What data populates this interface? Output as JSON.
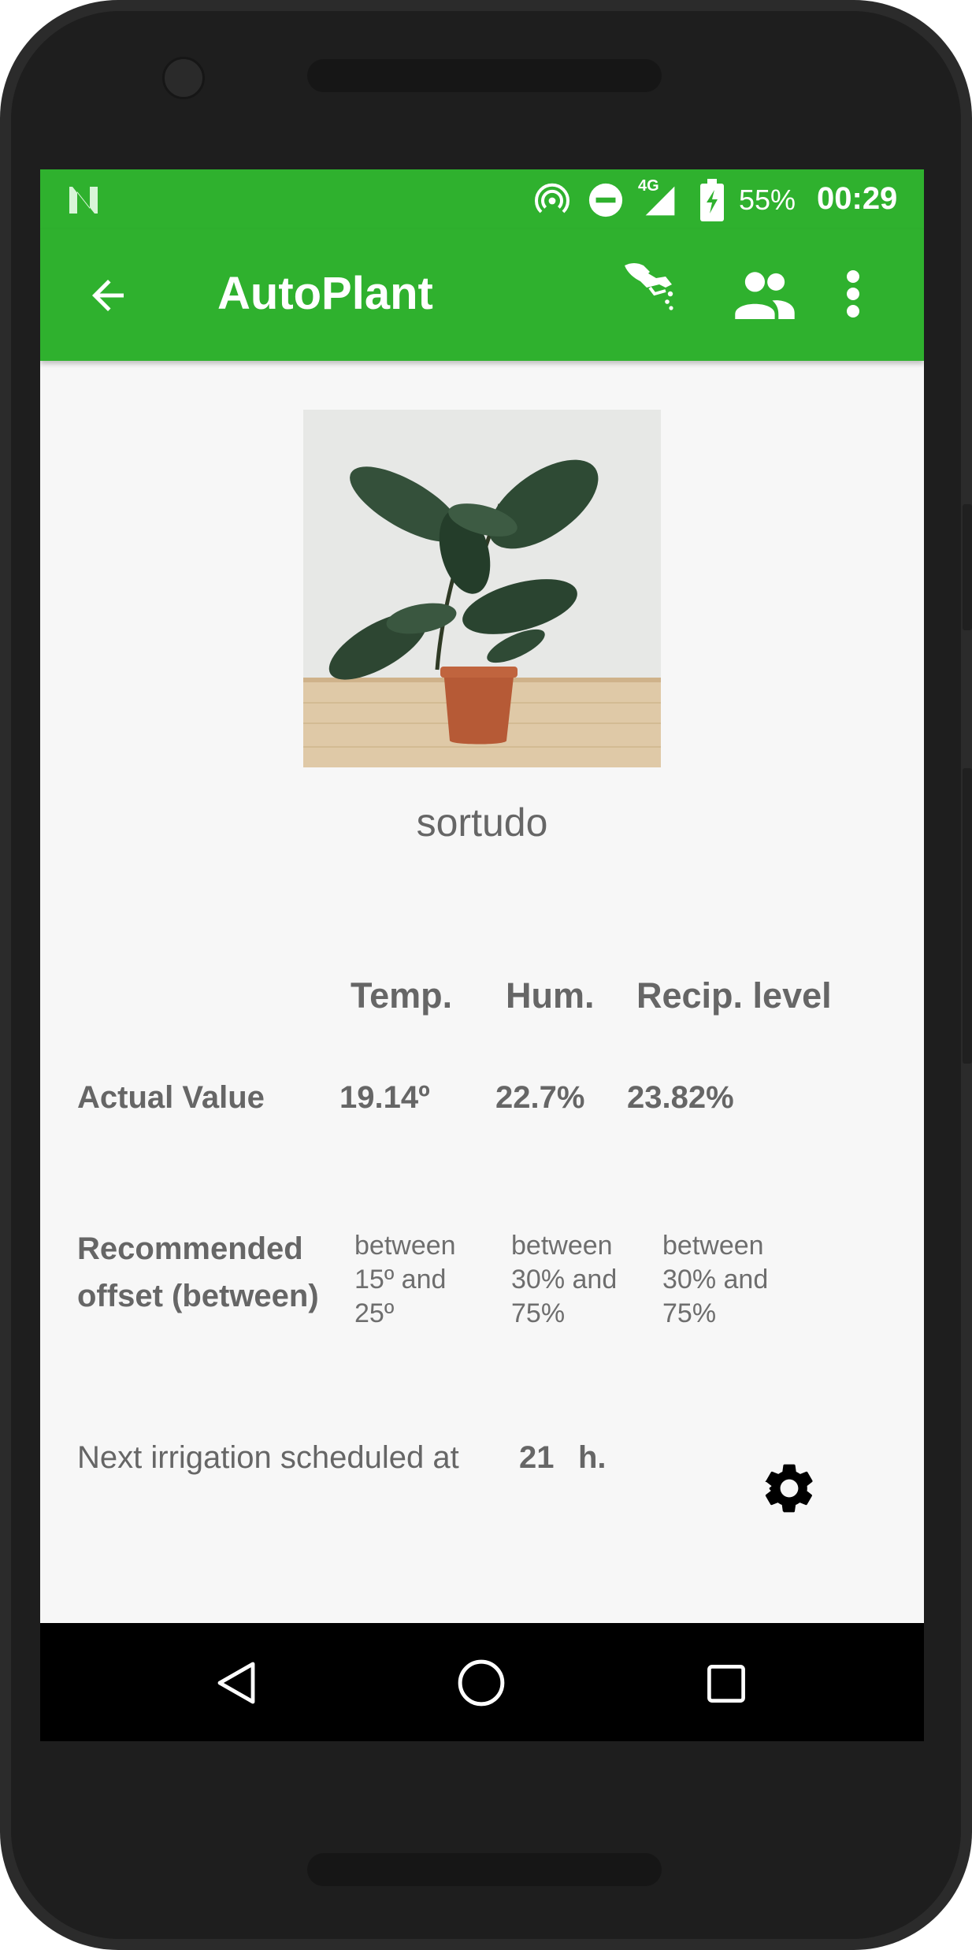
{
  "status_bar": {
    "battery_percent": "55%",
    "time": "00:29",
    "network_label": "4G",
    "icons": [
      "notification-n-icon",
      "hotspot-icon",
      "do-not-disturb-icon",
      "signal-icon",
      "battery-icon"
    ]
  },
  "app_bar": {
    "title": "AutoPlant",
    "actions": [
      "back-arrow-icon",
      "watering-can-icon",
      "people-icon",
      "more-vert-icon"
    ]
  },
  "plant": {
    "name": "sortudo"
  },
  "table": {
    "headers": [
      "Temp.",
      "Hum.",
      "Recip. level"
    ],
    "actual_label": "Actual Value",
    "actual_values": [
      "19.14º",
      "22.7%",
      "23.82%"
    ],
    "recommended_label_line1": "Recommended",
    "recommended_label_line2": "offset (between)",
    "recommended": [
      [
        "between",
        "15º and",
        "25º"
      ],
      [
        "between",
        "30% and",
        "75%"
      ],
      [
        "between",
        "30% and",
        "75%"
      ]
    ]
  },
  "irrigation": {
    "text": "Next irrigation scheduled at",
    "hour": "21",
    "unit": "h."
  },
  "colors": {
    "accent": "#2fb12e",
    "text_gray": "#666666",
    "background": "#f7f7f7"
  },
  "nav_bar": {
    "buttons": [
      "back-triangle-icon",
      "home-circle-icon",
      "recents-square-icon"
    ]
  }
}
